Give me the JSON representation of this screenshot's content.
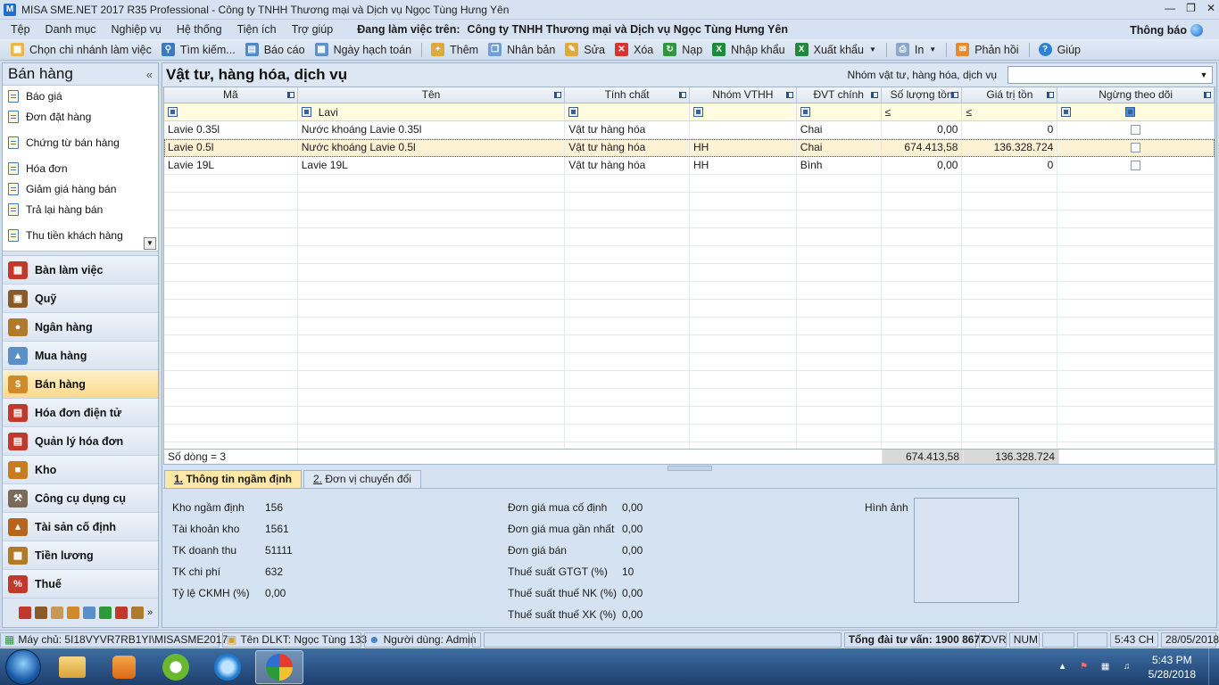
{
  "window": {
    "title": "MISA SME.NET 2017 R35 Professional - Công ty TNHH Thương mại và Dịch vụ Ngọc Tùng Hưng Yên"
  },
  "menu": {
    "items": [
      "Tệp",
      "Danh mục",
      "Nghiệp vụ",
      "Hệ thống",
      "Tiện ích",
      "Trợ giúp"
    ],
    "work_label": "Đang làm việc trên:",
    "work_value": "Công ty TNHH Thương mại và Dịch vụ Ngọc Tùng Hưng Yên",
    "notify": "Thông báo"
  },
  "toolbar": {
    "branch": "Chọn chi nhánh làm việc",
    "search": "Tìm kiếm...",
    "report": "Báo cáo",
    "posting_date": "Ngày hạch toán",
    "add": "Thêm",
    "duplicate": "Nhân bản",
    "edit": "Sửa",
    "delete": "Xóa",
    "reload": "Nạp",
    "import": "Nhập khẩu",
    "export": "Xuất khẩu",
    "print": "In",
    "feedback": "Phản hồi",
    "help": "Giúp"
  },
  "sidebar": {
    "title": "Bán hàng",
    "collapse": "«",
    "sub_items": [
      {
        "label": "Báo giá"
      },
      {
        "label": "Đơn đặt hàng"
      },
      {
        "label": "Chứng từ bán hàng"
      },
      {
        "label": "Hóa đơn"
      },
      {
        "label": "Giảm giá hàng bán"
      },
      {
        "label": "Trả lại hàng bán"
      },
      {
        "label": "Thu tiền khách hàng"
      }
    ],
    "modules": [
      {
        "label": "Bàn làm việc",
        "color": "#c0392b"
      },
      {
        "label": "Quỹ",
        "color": "#8a5a2b"
      },
      {
        "label": "Ngân hàng",
        "color": "#b07a2a"
      },
      {
        "label": "Mua hàng",
        "color": "#5b8fc7"
      },
      {
        "label": "Bán hàng",
        "color": "#d08a2a"
      },
      {
        "label": "Hóa đơn điện tử",
        "color": "#c0392b"
      },
      {
        "label": "Quản lý hóa đơn",
        "color": "#c0392b"
      },
      {
        "label": "Kho",
        "color": "#c77d1f"
      },
      {
        "label": "Công cụ dụng cụ",
        "color": "#7a6a5a"
      },
      {
        "label": "Tài sản cố định",
        "color": "#b5651d"
      },
      {
        "label": "Tiền lương",
        "color": "#b07a2a"
      },
      {
        "label": "Thuế",
        "color": "#c0392b"
      }
    ]
  },
  "main": {
    "title": "Vật tư, hàng hóa, dịch vụ",
    "group_label": "Nhóm vật tư, hàng hóa, dịch vụ",
    "group_value": ""
  },
  "grid": {
    "columns": [
      "Mã",
      "Tên",
      "Tính chất",
      "Nhóm VTHH",
      "ĐVT chính",
      "Số lượng tồn",
      "Giá trị tồn",
      "Ngừng theo dõi"
    ],
    "filter": {
      "name": "Lavi",
      "qty_op": "≤",
      "value_op": "≤"
    },
    "rows": [
      {
        "code": "Lavie 0.35l",
        "name": "Nước khoáng Lavie 0.35l",
        "type": "Vật tư hàng hóa",
        "group": "",
        "unit": "Chai",
        "qty": "0,00",
        "value": "0",
        "stopped": false,
        "selected": false
      },
      {
        "code": "Lavie 0.5l",
        "name": "Nước khoáng Lavie 0.5l",
        "type": "Vật tư hàng hóa",
        "group": "HH",
        "unit": "Chai",
        "qty": "674.413,58",
        "value": "136.328.724",
        "stopped": false,
        "selected": true
      },
      {
        "code": "Lavie 19L",
        "name": "Lavie 19L",
        "type": "Vật tư hàng hóa",
        "group": "HH",
        "unit": "Bình",
        "qty": "0,00",
        "value": "0",
        "stopped": false,
        "selected": false
      }
    ],
    "summary": {
      "count": "Số dòng = 3",
      "qty": "674.413,58",
      "value": "136.328.724"
    }
  },
  "tabs": [
    {
      "num": "1.",
      "label": " Thông tin ngầm định"
    },
    {
      "num": "2.",
      "label": " Đơn vị chuyển đổi"
    }
  ],
  "detail": {
    "left": [
      {
        "label": "Kho ngầm định",
        "value": "156"
      },
      {
        "label": "Tài khoản kho",
        "value": "1561"
      },
      {
        "label": "TK doanh thu",
        "value": "51111"
      },
      {
        "label": "TK chi phí",
        "value": "632"
      },
      {
        "label": "Tỷ lệ CKMH (%)",
        "value": "0,00"
      }
    ],
    "mid": [
      {
        "label": "Đơn giá mua cố định",
        "value": "0,00"
      },
      {
        "label": "Đơn giá mua gần nhất",
        "value": "0,00"
      },
      {
        "label": "Đơn giá bán",
        "value": "0,00"
      },
      {
        "label": "Thuế suất GTGT (%)",
        "value": "10"
      },
      {
        "label": "Thuế suất thuế NK (%)",
        "value": "0,00"
      },
      {
        "label": "Thuế suất thuế XK (%)",
        "value": "0,00"
      }
    ],
    "image_label": "Hình ảnh"
  },
  "statusbar": {
    "server": "Máy chủ: 5I18VYVR7RB1YI\\MISASME2017",
    "db": "Tên DLKT: Ngọc Tùng 133",
    "user": "Người dùng: Admin",
    "hotline": "Tổng đài tư vấn: 1900 8677",
    "ovr": "OVR",
    "num": "NUM",
    "time": "5:43 CH",
    "date": "28/05/2018"
  },
  "taskbar": {
    "clock_time": "5:43 PM",
    "clock_date": "5/28/2018"
  }
}
